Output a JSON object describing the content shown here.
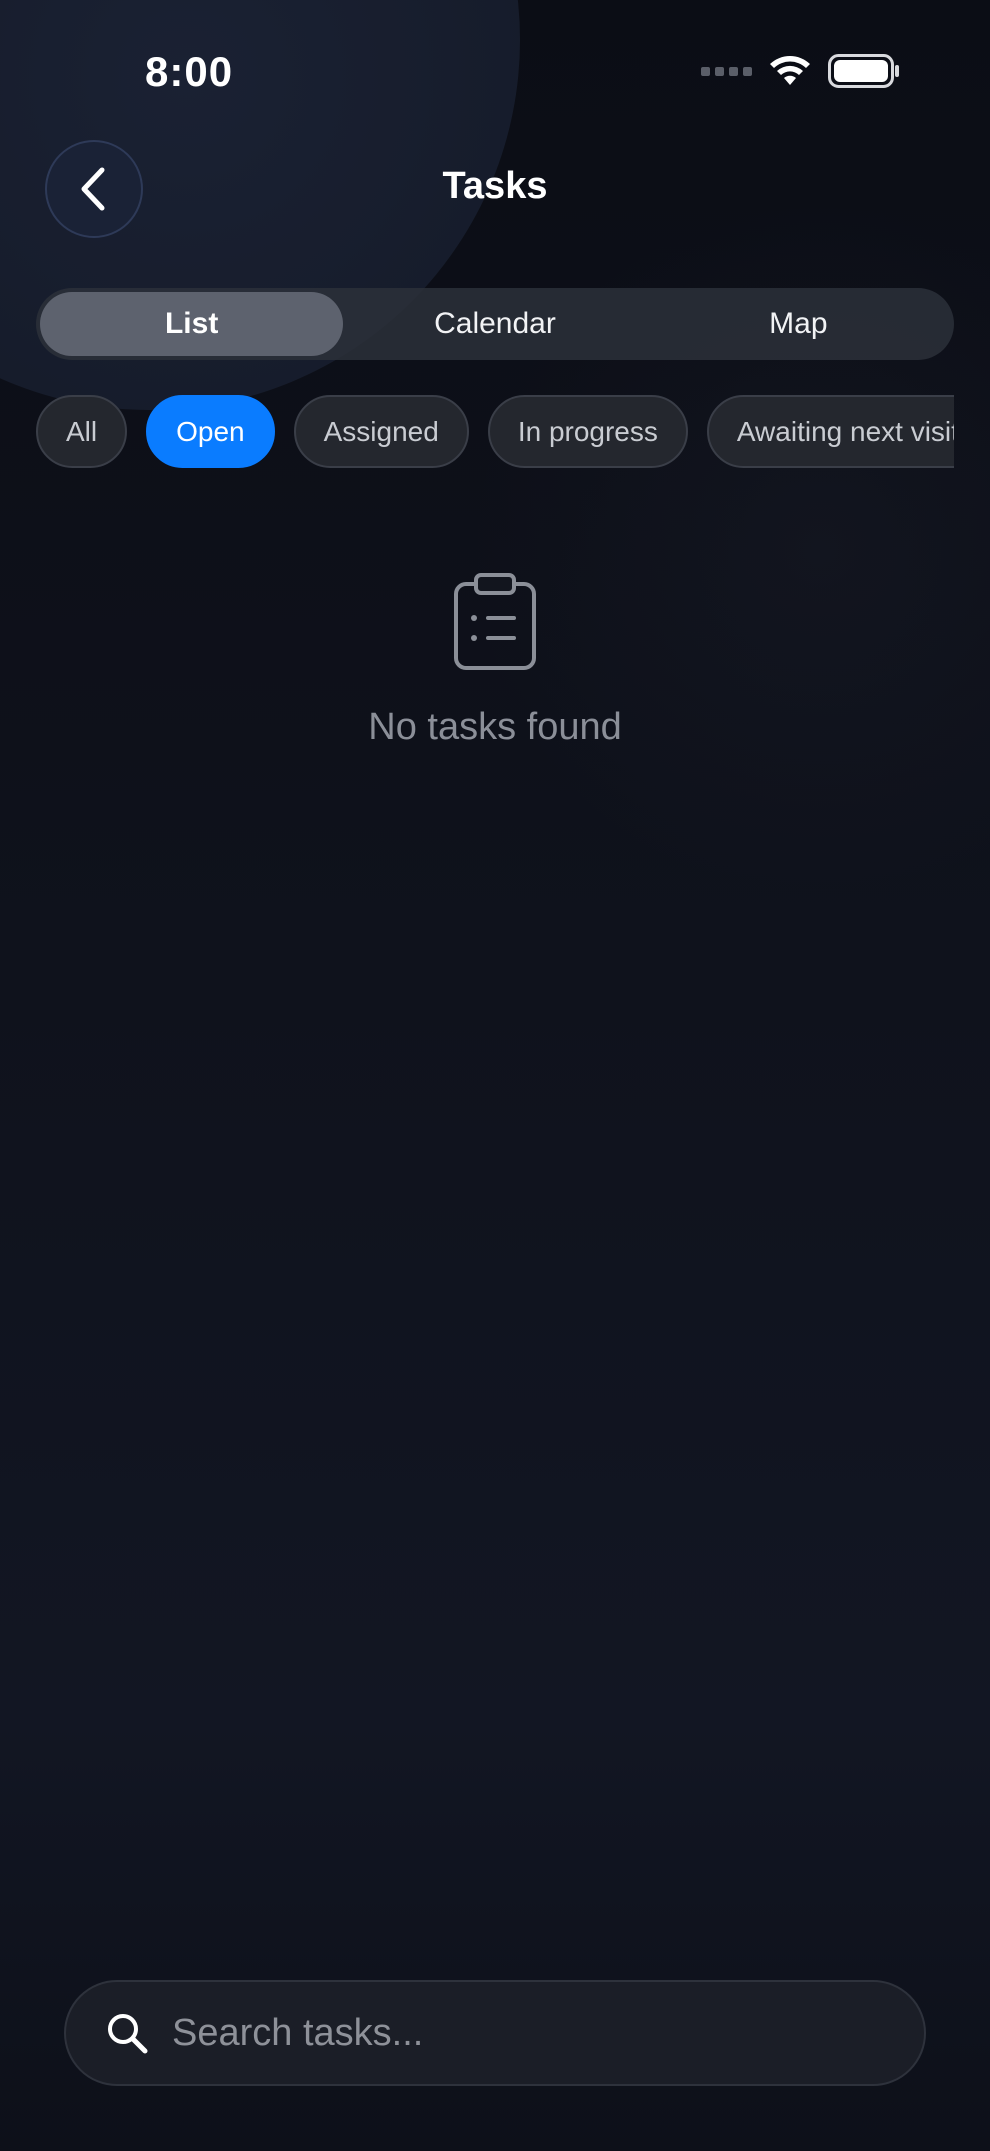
{
  "status_bar": {
    "time": "8:00"
  },
  "header": {
    "title": "Tasks",
    "back_icon": "chevron-left-icon"
  },
  "view_tabs": [
    {
      "label": "List",
      "active": true
    },
    {
      "label": "Calendar",
      "active": false
    },
    {
      "label": "Map",
      "active": false
    }
  ],
  "filters": [
    {
      "label": "All",
      "active": false
    },
    {
      "label": "Open",
      "active": true
    },
    {
      "label": "Assigned",
      "active": false
    },
    {
      "label": "In progress",
      "active": false
    },
    {
      "label": "Awaiting next visit",
      "active": false
    }
  ],
  "empty_state": {
    "icon": "clipboard-list-icon",
    "message": "No tasks found"
  },
  "search": {
    "placeholder": "Search tasks...",
    "value": ""
  },
  "colors": {
    "accent": "#0a7cff",
    "background": "#0e111a",
    "segment_active": "#5d626e"
  }
}
